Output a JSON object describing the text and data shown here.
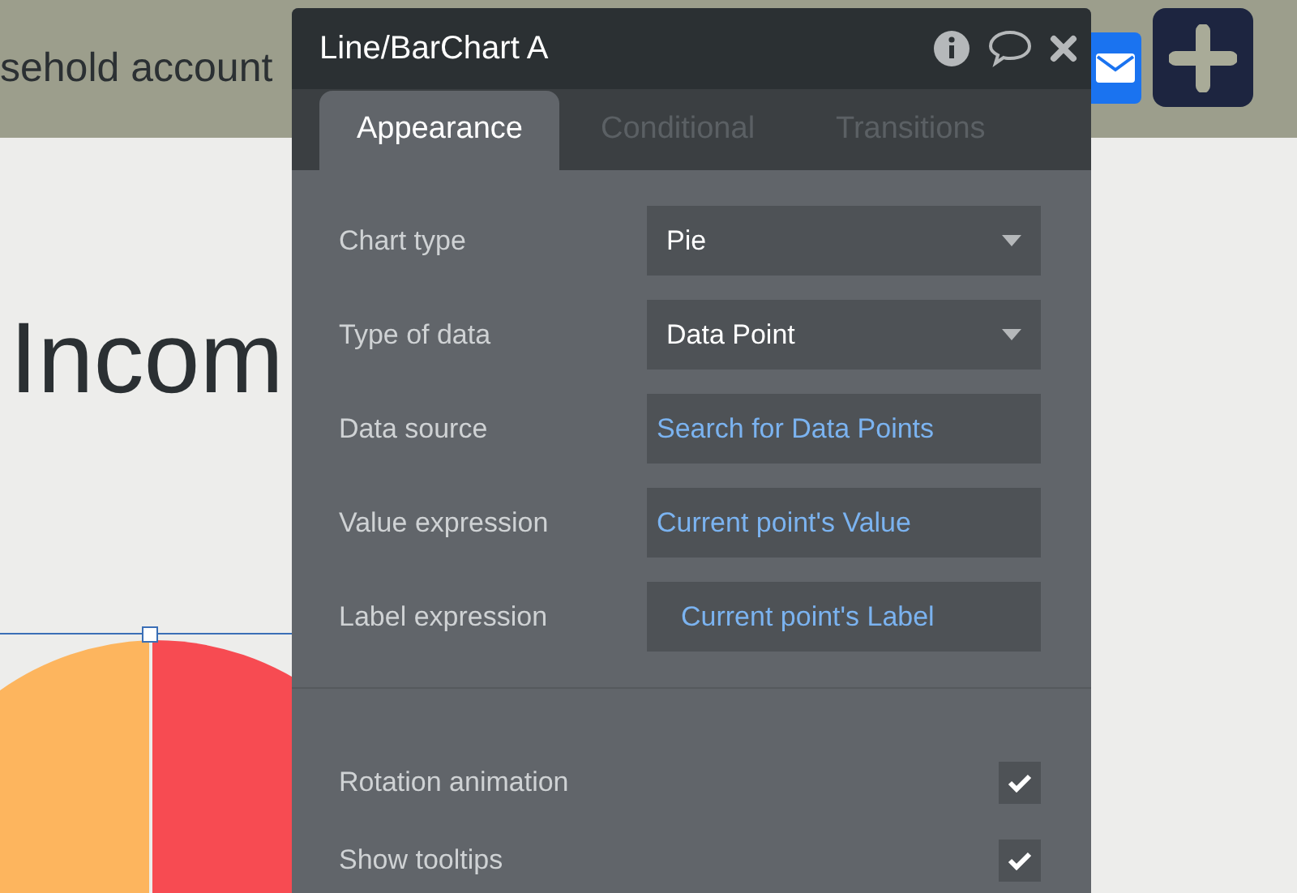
{
  "page": {
    "header_text": "sehold account",
    "heading": "Incom"
  },
  "panel": {
    "title": "Line/BarChart A",
    "tabs": [
      {
        "label": "Appearance",
        "selected": true
      },
      {
        "label": "Conditional",
        "selected": false
      },
      {
        "label": "Transitions",
        "selected": false
      }
    ],
    "fields": [
      {
        "label": "Chart type",
        "kind": "dropdown",
        "value": "Pie"
      },
      {
        "label": "Type of data",
        "kind": "dropdown",
        "value": "Data Point"
      },
      {
        "label": "Data source",
        "kind": "expression",
        "value": "Search for Data Points"
      },
      {
        "label": "Value expression",
        "kind": "expression",
        "value": "Current point's Value"
      },
      {
        "label": "Label expression",
        "kind": "expression",
        "value": "Current point's Label"
      }
    ],
    "options": [
      {
        "label": "Rotation animation",
        "checked": true
      },
      {
        "label": "Show tooltips",
        "checked": true
      }
    ]
  }
}
